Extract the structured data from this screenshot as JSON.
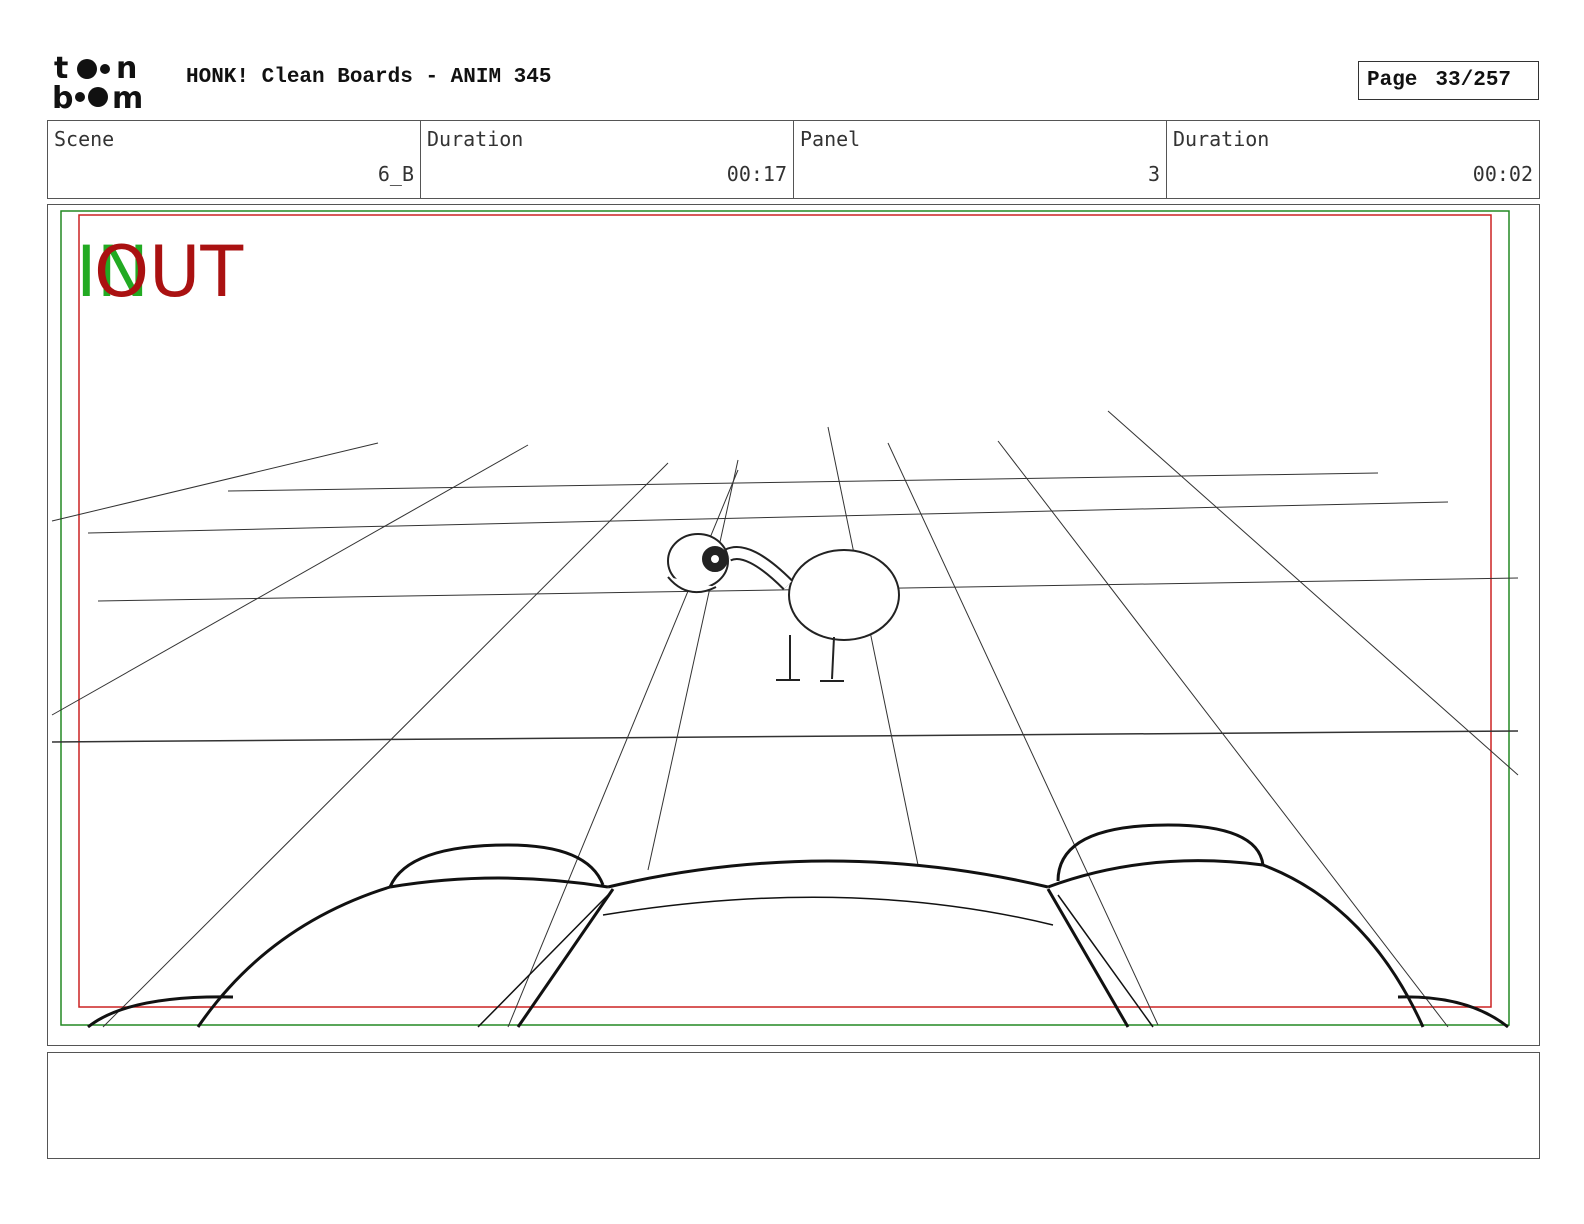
{
  "logo": {
    "top_text": "toon",
    "bottom_text": "boom"
  },
  "header": {
    "title": "HONK! Clean Boards - ANIM 345",
    "page_label": "Page",
    "page_number": "33/257"
  },
  "info": {
    "scene_label": "Scene",
    "scene_value": "6_B",
    "scene_duration_label": "Duration",
    "scene_duration_value": "00:17",
    "panel_label": "Panel",
    "panel_value": "3",
    "panel_duration_label": "Duration",
    "panel_duration_value": "00:02"
  },
  "panel": {
    "transition_in": "IN",
    "transition_out": "OUT",
    "colors": {
      "in": "#22aa22",
      "out": "#aa1111",
      "safe_frame": "#cc2222",
      "camera_frame": "#228822"
    }
  },
  "notes": {
    "text": ""
  }
}
